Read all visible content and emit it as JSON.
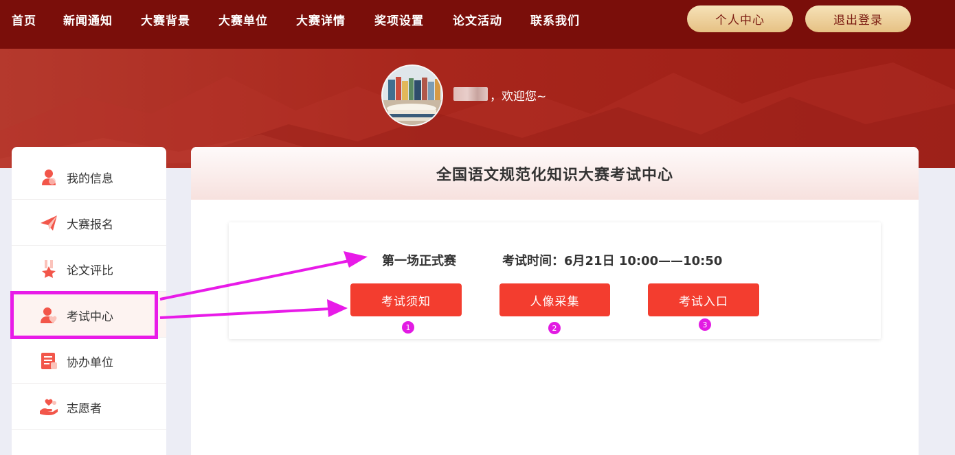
{
  "nav": {
    "items": [
      "首页",
      "新闻通知",
      "大赛背景",
      "大赛单位",
      "大赛详情",
      "奖项设置",
      "论文活动",
      "联系我们"
    ],
    "personal_center": "个人中心",
    "logout": "退出登录"
  },
  "welcome": {
    "text": "，欢迎您~"
  },
  "sidebar": {
    "items": [
      {
        "label": "我的信息",
        "icon": "user-icon"
      },
      {
        "label": "大赛报名",
        "icon": "paper-plane-icon"
      },
      {
        "label": "论文评比",
        "icon": "medal-icon"
      },
      {
        "label": "考试中心",
        "icon": "user-heart-icon",
        "active": true
      },
      {
        "label": "协办单位",
        "icon": "document-list-icon"
      },
      {
        "label": "志愿者",
        "icon": "hand-heart-icon"
      }
    ]
  },
  "main": {
    "title": "全国语文规范化知识大赛考试中心",
    "round_name": "第一场正式赛",
    "exam_time": "考试时间：6月21日 10:00——10:50",
    "buttons": [
      "考试须知",
      "人像采集",
      "考试入口"
    ],
    "steps": [
      "1",
      "2",
      "3"
    ]
  },
  "colors": {
    "nav_bg": "#7a0e0a",
    "banner": "#a8261c",
    "button_red": "#f33d2f",
    "gold_button": "#e6c184",
    "annotation_magenta": "#e81be8"
  }
}
